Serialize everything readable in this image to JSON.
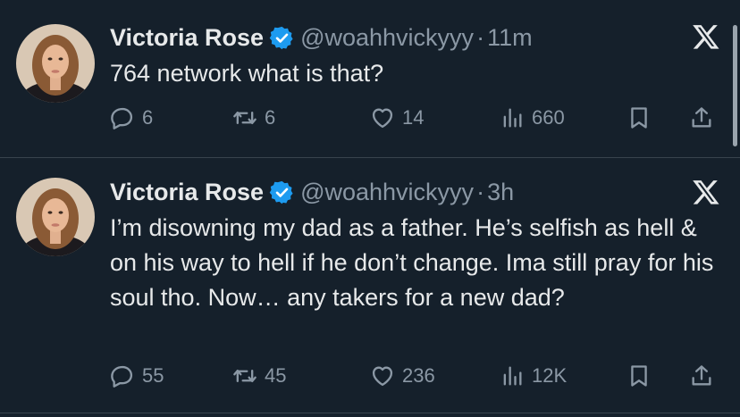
{
  "tweets": [
    {
      "author_name": "Victoria Rose",
      "handle": "@woahhvickyyy",
      "separator": "·",
      "time": "11m",
      "text": "764 network what is that?",
      "stats": {
        "replies": "6",
        "retweets": "6",
        "likes": "14",
        "views": "660"
      }
    },
    {
      "author_name": "Victoria Rose",
      "handle": "@woahhvickyyy",
      "separator": "·",
      "time": "3h",
      "text": "I’m disowning my dad as a father. He’s selfish as hell & on his way to hell if he don’t change. Ima still pray for his soul tho. Now… any takers for a new dad?",
      "stats": {
        "replies": "55",
        "retweets": "45",
        "likes": "236",
        "views": "12K"
      }
    }
  ],
  "colors": {
    "background": "#15202b",
    "text_primary": "#e7e9ea",
    "text_secondary": "#8b98a5",
    "verified_badge": "#1d9bf0",
    "divider": "#38444d"
  },
  "icons": [
    "verified-badge-icon",
    "x-logo-icon",
    "reply-icon",
    "retweet-icon",
    "like-icon",
    "views-icon",
    "bookmark-icon",
    "share-icon"
  ]
}
